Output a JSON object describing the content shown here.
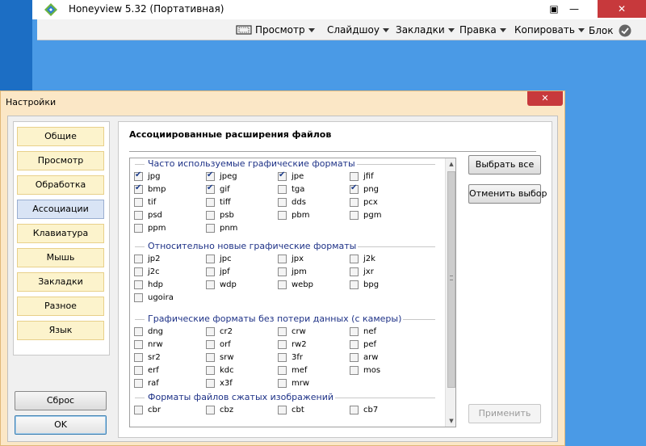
{
  "app": {
    "title": "Honeyview 5.32 (Портативная)",
    "window_buttons": {
      "fullscreen": "▣",
      "minimize": "—",
      "maximize": "☐",
      "close": "✕"
    },
    "toolbar": [
      {
        "label": "Просмотр",
        "icon": "fullscreen-view-icon"
      },
      {
        "label": "Слайдшоу"
      },
      {
        "label": "Закладки"
      },
      {
        "label": "Правка"
      },
      {
        "label": "Копировать"
      },
      {
        "label": "Блок",
        "icon": "checkmark-circle-icon"
      }
    ]
  },
  "dialog": {
    "title": "Настройки",
    "close": "✕",
    "sidebar": {
      "items": [
        "Общие",
        "Просмотр",
        "Обработка",
        "Ассоциации",
        "Клавиатура",
        "Мышь",
        "Закладки",
        "Разное",
        "Язык"
      ],
      "active_index": 3
    },
    "reset_label": "Сброс",
    "ok_label": "OK",
    "page_title": "Ассоциированные расширения файлов",
    "select_all_label": "Выбрать все",
    "deselect_label": "Отменить выбор",
    "apply_label": "Применить",
    "groups": [
      {
        "title": "Часто используемые графические форматы",
        "items": [
          {
            "label": "jpg",
            "checked": true
          },
          {
            "label": "jpeg",
            "checked": true
          },
          {
            "label": "jpe",
            "checked": true
          },
          {
            "label": "jfif",
            "checked": false
          },
          {
            "label": "bmp",
            "checked": true
          },
          {
            "label": "gif",
            "checked": true
          },
          {
            "label": "tga",
            "checked": false
          },
          {
            "label": "png",
            "checked": true
          },
          {
            "label": "tif",
            "checked": false
          },
          {
            "label": "tiff",
            "checked": false
          },
          {
            "label": "dds",
            "checked": false
          },
          {
            "label": "pcx",
            "checked": false
          },
          {
            "label": "psd",
            "checked": false
          },
          {
            "label": "psb",
            "checked": false
          },
          {
            "label": "pbm",
            "checked": false
          },
          {
            "label": "pgm",
            "checked": false
          },
          {
            "label": "ppm",
            "checked": false
          },
          {
            "label": "pnm",
            "checked": false
          }
        ]
      },
      {
        "title": "Относительно новые графические форматы",
        "items": [
          {
            "label": "jp2",
            "checked": false
          },
          {
            "label": "jpc",
            "checked": false
          },
          {
            "label": "jpx",
            "checked": false
          },
          {
            "label": "j2k",
            "checked": false
          },
          {
            "label": "j2c",
            "checked": false
          },
          {
            "label": "jpf",
            "checked": false
          },
          {
            "label": "jpm",
            "checked": false
          },
          {
            "label": "jxr",
            "checked": false
          },
          {
            "label": "hdp",
            "checked": false
          },
          {
            "label": "wdp",
            "checked": false
          },
          {
            "label": "webp",
            "checked": false
          },
          {
            "label": "bpg",
            "checked": false
          },
          {
            "label": "ugoira",
            "checked": false
          }
        ]
      },
      {
        "title": "Графические форматы без потери данных (с камеры)",
        "items": [
          {
            "label": "dng",
            "checked": false
          },
          {
            "label": "cr2",
            "checked": false
          },
          {
            "label": "crw",
            "checked": false
          },
          {
            "label": "nef",
            "checked": false
          },
          {
            "label": "nrw",
            "checked": false
          },
          {
            "label": "orf",
            "checked": false
          },
          {
            "label": "rw2",
            "checked": false
          },
          {
            "label": "pef",
            "checked": false
          },
          {
            "label": "sr2",
            "checked": false
          },
          {
            "label": "srw",
            "checked": false
          },
          {
            "label": "3fr",
            "checked": false
          },
          {
            "label": "arw",
            "checked": false
          },
          {
            "label": "erf",
            "checked": false
          },
          {
            "label": "kdc",
            "checked": false
          },
          {
            "label": "mef",
            "checked": false
          },
          {
            "label": "mos",
            "checked": false
          },
          {
            "label": "raf",
            "checked": false
          },
          {
            "label": "x3f",
            "checked": false
          },
          {
            "label": "mrw",
            "checked": false
          }
        ]
      },
      {
        "title": "Форматы файлов сжатых изображений",
        "items": [
          {
            "label": "cbr",
            "checked": false
          },
          {
            "label": "cbz",
            "checked": false
          },
          {
            "label": "cbt",
            "checked": false
          },
          {
            "label": "cb7",
            "checked": false
          }
        ]
      }
    ]
  },
  "colors": {
    "desktop": "#3a8fdd",
    "dialog_frame": "#fbe7c6",
    "close_red": "#c7393c",
    "group_title": "#1e3287"
  }
}
